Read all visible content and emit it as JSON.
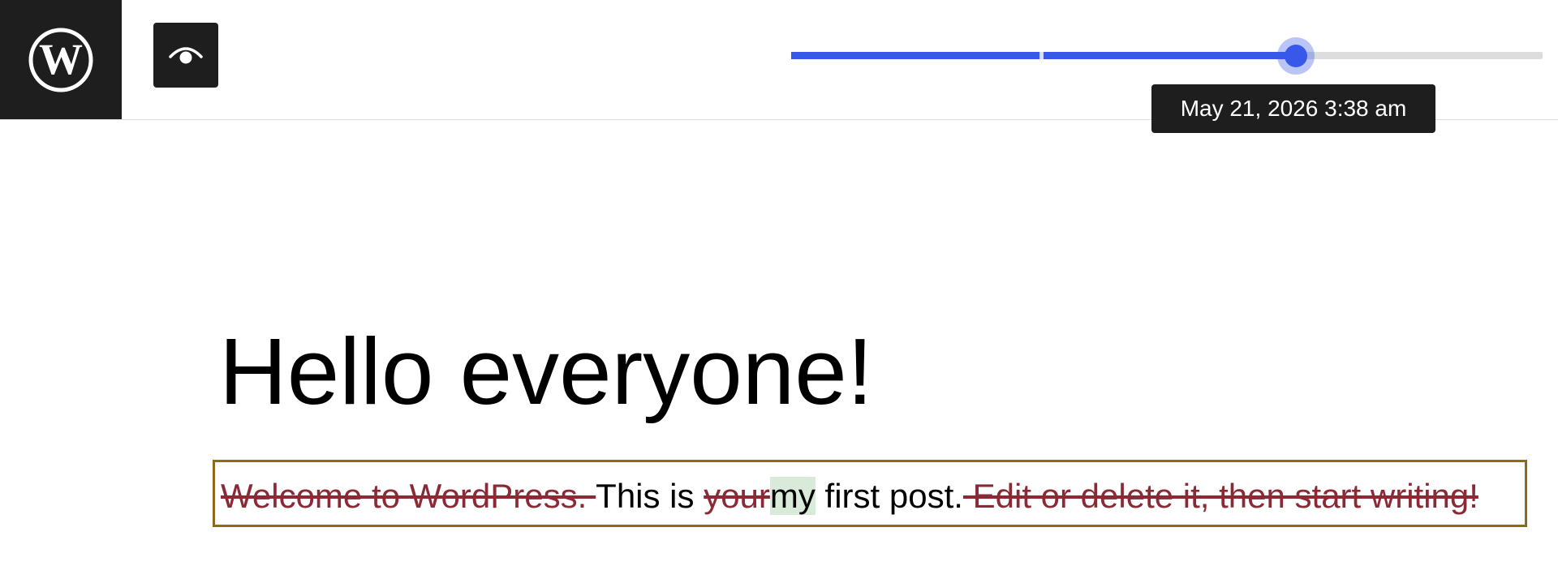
{
  "toolbar": {
    "logo_icon": "wordpress-logo-icon",
    "preview_icon": "eye-icon",
    "revision_slider": {
      "selected_fraction": 0.65,
      "tooltip": "May 21, 2026 3:38 am"
    }
  },
  "post": {
    "title": "Hello everyone!",
    "diff": {
      "removed_1": "Welcome to WordPress. ",
      "text_1": "This is ",
      "removed_2": "your",
      "added_1": "my",
      "text_2": " first post.",
      "removed_3": " Edit or delete it, then start writing!"
    }
  },
  "colors": {
    "accent": "#3858e9",
    "dark": "#1e1e1e",
    "removed": "#8a2a35",
    "added_bg": "#d9eadb",
    "block_outline": "#8c6b1f"
  }
}
